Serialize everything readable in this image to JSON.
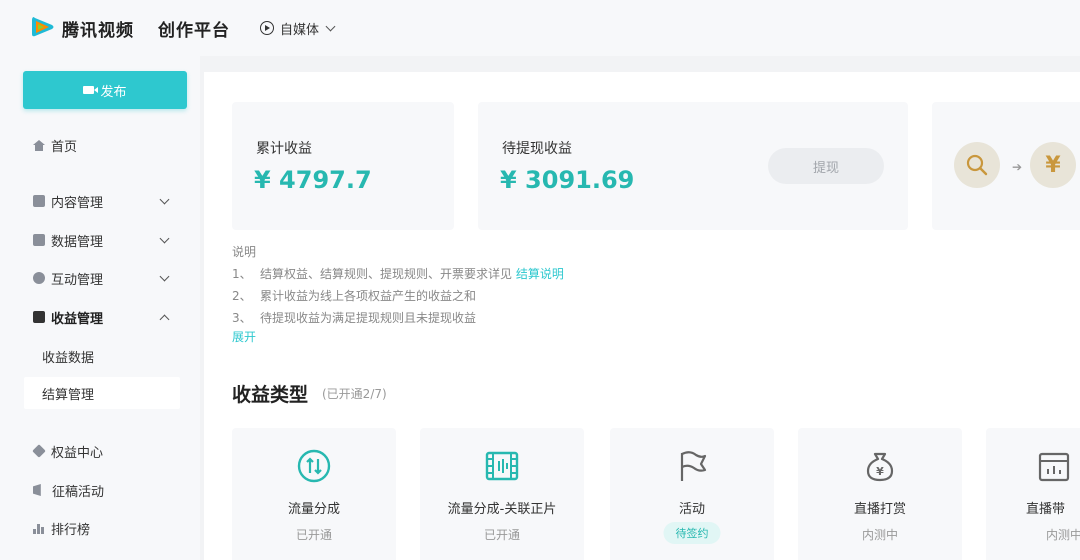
{
  "header": {
    "brand": "腾讯视频",
    "platform": "创作平台",
    "media_label": "自媒体"
  },
  "sidebar": {
    "publish_label": "发布",
    "items": [
      {
        "label": "首页"
      },
      {
        "label": "内容管理"
      },
      {
        "label": "数据管理"
      },
      {
        "label": "互动管理"
      },
      {
        "label": "收益管理"
      },
      {
        "label": "收益数据"
      },
      {
        "label": "结算管理"
      },
      {
        "label": "权益中心"
      },
      {
        "label": "征稿活动"
      },
      {
        "label": "排行榜"
      }
    ]
  },
  "earnings": {
    "total_label": "累计收益",
    "total_value": "¥ 4797.7",
    "pending_label": "待提现收益",
    "pending_value": "¥ 3091.69",
    "withdraw_label": "提现",
    "flow_yuan": "¥"
  },
  "notes": {
    "title": "说明",
    "items": [
      {
        "num": "1、",
        "text": "结算权益、结算规则、提现规则、开票要求详见",
        "link": "结算说明"
      },
      {
        "num": "2、",
        "text": "累计收益为线上各项权益产生的收益之和"
      },
      {
        "num": "3、",
        "text": "待提现收益为满足提现规则且未提现收益"
      }
    ],
    "expand": "展开"
  },
  "revenue_types": {
    "title": "收益类型",
    "subtitle": "(已开通2/7)",
    "cards": [
      {
        "name": "流量分成",
        "status": "已开通"
      },
      {
        "name": "流量分成-关联正片",
        "status": "已开通"
      },
      {
        "name": "活动",
        "status": "待签约"
      },
      {
        "name": "直播打赏",
        "status": "内测中"
      },
      {
        "name": "直播带",
        "status": "内测中"
      }
    ]
  },
  "colors": {
    "accent": "#2ec8cf",
    "value_teal": "#27b8b0",
    "gold": "#c9973d"
  }
}
